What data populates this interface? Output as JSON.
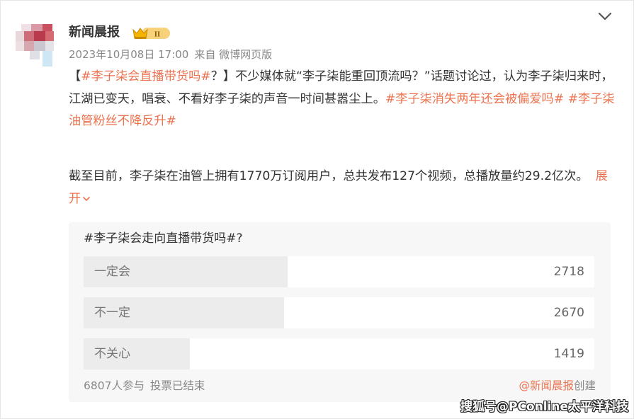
{
  "post": {
    "author": "新闻晨报",
    "badge_icon": "crown-level-badge-icon",
    "badge_text": "II",
    "date": "2023年10月08日 17:00",
    "source": "来自 微博网页版",
    "collapse_icon": "chevron-down-icon",
    "text": {
      "bracket_open": "【",
      "tag1": "#李子柒会直播带货吗#",
      "seg1": "？】不少媒体就“李子柒能重回顶流吗？”话题讨论过，认为李子柒归来时，江湖已变天，唱衰、不看好李子柒的声音一时间甚嚣尘上。",
      "tag2": "#李子柒消失两年还会被偏爱吗#",
      "space": " ",
      "tag3": "#李子柒油管粉丝不降反升#"
    },
    "para2": "截至目前，李子柒在油管上拥有1770万订阅用户，总共发布127个视频，总播放量约29.2亿次。",
    "expand_label": "展开"
  },
  "poll": {
    "title": "#李子柒会走向直播带货吗#?",
    "options": [
      {
        "label": "一定会",
        "count": "2718",
        "share": 0.3993
      },
      {
        "label": "不一定",
        "count": "2670",
        "share": 0.3922
      },
      {
        "label": "不关心",
        "count": "1419",
        "share": 0.2085
      }
    ],
    "participants": "6807人参与",
    "status": "投票已结束",
    "creator_name": "@新闻晨报",
    "creator_suffix": "创建"
  },
  "watermark": "搜狐号@PConline太平洋科技",
  "colors": {
    "accent": "#eb7350",
    "text": "#333333",
    "meta": "#888888",
    "poll_bg": "#f7f7f7",
    "poll_fill": "#ececec",
    "badge_gold": "#f5b400"
  }
}
